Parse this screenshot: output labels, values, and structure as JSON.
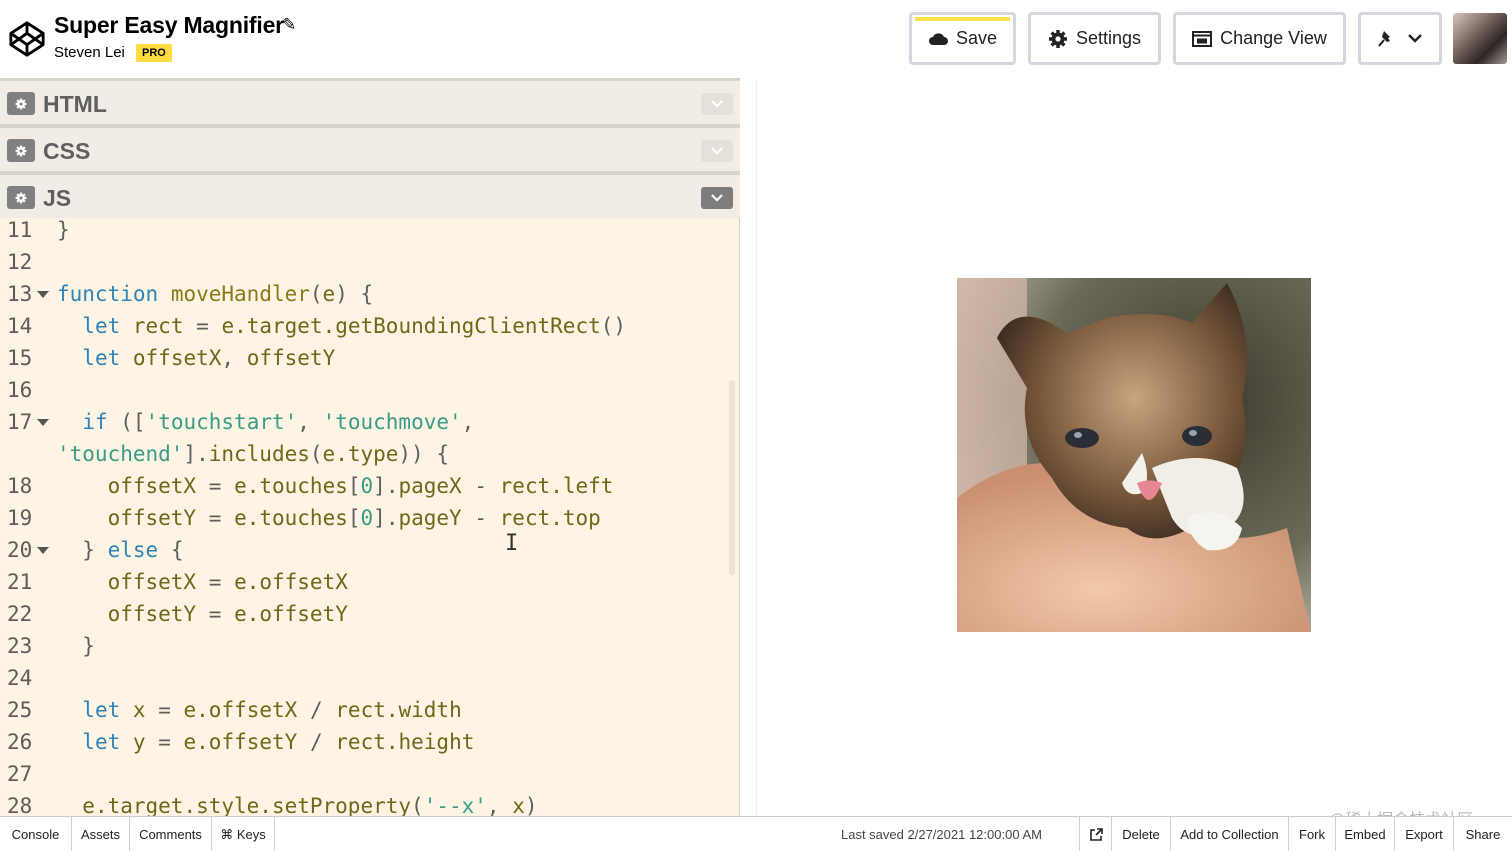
{
  "header": {
    "title": "Super Easy Magnifier",
    "author": "Steven Lei",
    "badge": "PRO",
    "buttons": {
      "save": "Save",
      "settings": "Settings",
      "change_view": "Change View"
    },
    "icons": [
      "codepen-logo-icon",
      "pencil-icon",
      "cloud-icon",
      "gear-icon",
      "change-view-icon",
      "pin-icon",
      "chevron-down-icon"
    ]
  },
  "panels": [
    {
      "name": "HTML"
    },
    {
      "name": "CSS"
    },
    {
      "name": "JS"
    }
  ],
  "code": {
    "lines": [
      {
        "n": "11"
      },
      {
        "n": "12"
      },
      {
        "n": "13"
      },
      {
        "n": "14"
      },
      {
        "n": "15"
      },
      {
        "n": "16"
      },
      {
        "n": "17"
      },
      {
        "n": "18"
      },
      {
        "n": "19"
      },
      {
        "n": "20"
      },
      {
        "n": "21"
      },
      {
        "n": "22"
      },
      {
        "n": "23"
      },
      {
        "n": "24"
      },
      {
        "n": "25"
      },
      {
        "n": "26"
      },
      {
        "n": "27"
      },
      {
        "n": "28"
      }
    ]
  },
  "preview": {
    "image_alt": "kitten photo",
    "watermark": "@稀土掘金技术社区"
  },
  "footer": {
    "console": "Console",
    "assets": "Assets",
    "comments": "Comments",
    "keys": "⌘ Keys",
    "last_saved_label": "Last saved",
    "last_saved_time": "2/27/2021 12:00:00 AM",
    "delete": "Delete",
    "add_to_collection": "Add to Collection",
    "fork": "Fork",
    "embed": "Embed",
    "export": "Export",
    "share": "Share"
  },
  "colors": {
    "editor_bg": "#fdf4e3",
    "keyword": "#2e84b8",
    "string": "#3a9b87",
    "save_accent": "#ffe14a",
    "pro_badge": "#ffdd40"
  }
}
